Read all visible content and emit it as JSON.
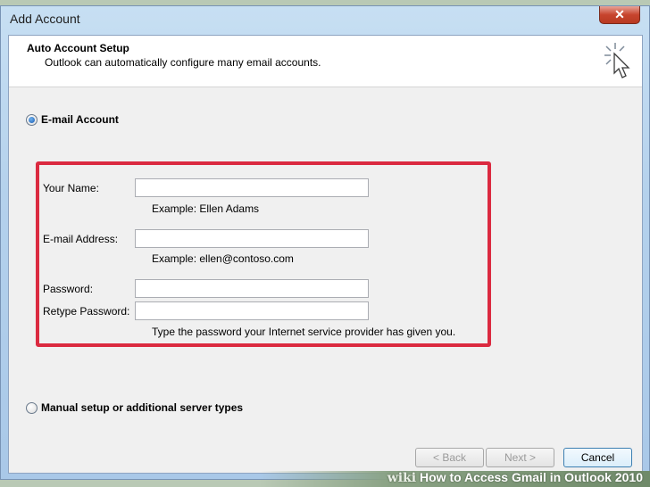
{
  "window": {
    "title": "Add Account",
    "close_label": "✕"
  },
  "header": {
    "title": "Auto Account Setup",
    "subtitle": "Outlook can automatically configure many email accounts."
  },
  "options": {
    "email_account_label": "E-mail Account",
    "manual_setup_label": "Manual setup or additional server types"
  },
  "form": {
    "name_label": "Your Name:",
    "name_value": "",
    "name_hint": "Example: Ellen Adams",
    "email_label": "E-mail Address:",
    "email_value": "",
    "email_hint": "Example: ellen@contoso.com",
    "password_label": "Password:",
    "password_value": "",
    "retype_label": "Retype Password:",
    "retype_value": "",
    "password_hint": "Type the password your Internet service provider has given you."
  },
  "buttons": {
    "back": "< Back",
    "next": "Next >",
    "cancel": "Cancel"
  },
  "watermark": {
    "brand": "wiki",
    "text": "How to Access Gmail in Outlook 2010"
  },
  "colors": {
    "highlight": "#db2a40",
    "close": "#c7442e"
  }
}
